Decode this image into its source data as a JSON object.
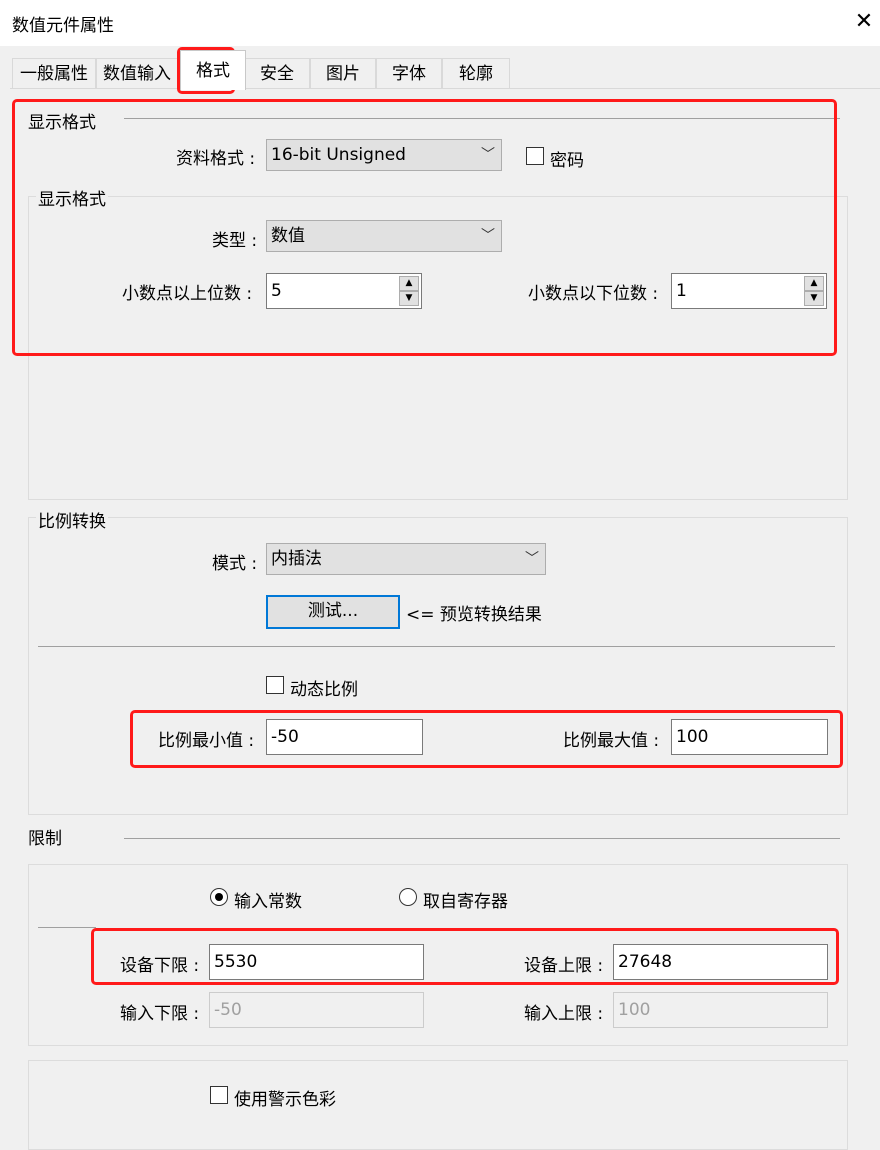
{
  "window": {
    "title": "数值元件属性",
    "close_icon": "close-icon"
  },
  "tabs": [
    {
      "label": "一般属性"
    },
    {
      "label": "数值输入"
    },
    {
      "label": "格式",
      "active": true
    },
    {
      "label": "安全"
    },
    {
      "label": "图片"
    },
    {
      "label": "字体"
    },
    {
      "label": "轮廓"
    }
  ],
  "display_format": {
    "section_title": "显示格式",
    "data_format_label": "资料格式 :",
    "data_format_value": "16-bit Unsigned",
    "password_label": "密码",
    "password_checked": false,
    "sub_title": "显示格式",
    "type_label": "类型 :",
    "type_value": "数值",
    "int_digits_label": "小数点以上位数 :",
    "int_digits_value": "5",
    "dec_digits_label": "小数点以下位数 :",
    "dec_digits_value": "1"
  },
  "scaling": {
    "section_title": "比例转换",
    "mode_label": "模式 :",
    "mode_value": "内插法",
    "test_button": "测试...",
    "preview_text": "<= 预览转换结果",
    "dynamic_label": "动态比例",
    "dynamic_checked": false,
    "min_label": "比例最小值 :",
    "min_value": "-50",
    "max_label": "比例最大值 :",
    "max_value": "100"
  },
  "limits": {
    "section_title": "限制",
    "const_label": "输入常数",
    "register_label": "取自寄存器",
    "selected": "输入常数",
    "dev_low_label": "设备下限 :",
    "dev_low_value": "5530",
    "dev_high_label": "设备上限 :",
    "dev_high_value": "27648",
    "in_low_label": "输入下限 :",
    "in_low_value": "-50",
    "in_high_label": "输入上限 :",
    "in_high_value": "100"
  },
  "alarm": {
    "use_color_label": "使用警示色彩",
    "checked": false
  },
  "colors": {
    "highlight": "#ff1a1a",
    "focus": "#0078d7"
  }
}
